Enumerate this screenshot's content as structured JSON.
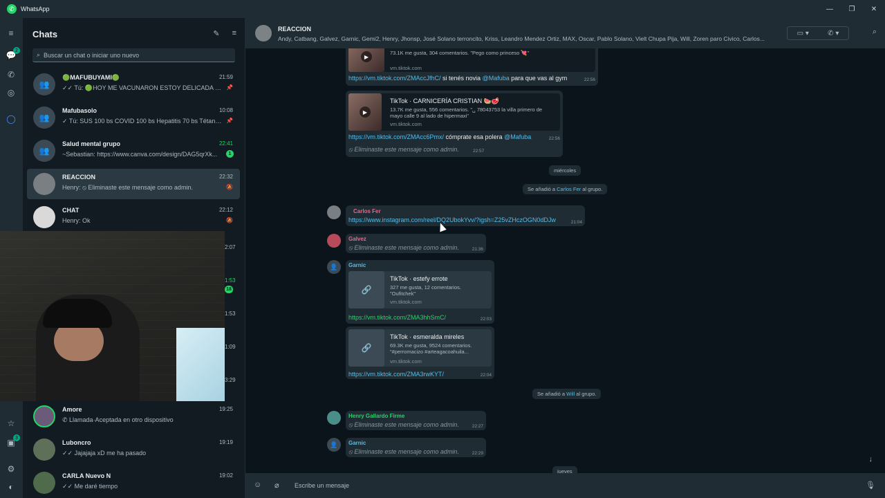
{
  "window": {
    "title": "WhatsApp"
  },
  "rail": {
    "chats_badge": "2",
    "updates_badge": "3"
  },
  "sidebar": {
    "title": "Chats",
    "search_placeholder": "Buscar un chat o iniciar uno nuevo",
    "chats": [
      {
        "name": "🟢MAFUBUYAMI🟢",
        "time": "21:59",
        "preview": "✓✓ Tú: 🟢HOY ME VACUNARON ESTOY DELICADA TRA..."
      },
      {
        "name": "Mafubasolo",
        "time": "10:08",
        "preview": "✓ Tú: SUS 100 bs COVID 100 bs Hepatitis 70 bs Tétano..."
      },
      {
        "name": "Salud mental grupo",
        "time": "22:41",
        "preview": "~Sebastian: https://www.canva.com/design/DAG5qrXk...",
        "unread": "1"
      },
      {
        "name": "REACCION",
        "time": "22:32",
        "preview": "Henry: ⦸ Eliminaste este mensaje como admin."
      },
      {
        "name": "CHAT",
        "time": "22:12",
        "preview": "Henry: Ok"
      },
      {
        "name": "Amore",
        "time": "19:25",
        "preview": "✆ Llamada·Aceptada en otro dispositivo"
      },
      {
        "name": "Luboncro",
        "time": "19:19",
        "preview": "✓✓ Jajajaja xD me ha pasado"
      },
      {
        "name": "CARLA Nuevo N",
        "time": "19:02",
        "preview": "✓✓ Me daré tiempo"
      }
    ],
    "hidden_times": [
      "2:07",
      "1:53",
      "1:53",
      "1:09",
      "3:29"
    ],
    "hidden_unread": "18"
  },
  "header": {
    "group_name": "REACCION",
    "members": "Andy, Catbang, Galvez, Garnic, Gemi2, Henry, Jhonsp, José Solano terroncito, Kriss, Leandro Mendez Ortiz, MAX, Oscar, Pablo Solano, Vielt Chupa Pija, Will, Zoren paro Civico,   Carlos..."
  },
  "messages": {
    "card1": {
      "desc": "73.1K me gusta, 304 comentarios. \"Pego como princeso 💘\"",
      "domain": "vm.tiktok.com"
    },
    "msg1": {
      "link": "https://vm.tiktok.com/ZMAccJfhC/",
      "text": " si tenés novia ",
      "mention": "@Mafuba",
      "text2": "  para que vas al gym",
      "time": "22:56"
    },
    "card2": {
      "title": "TikTok · CARNICERÍA CRISTIAN 🍉🥩",
      "desc": "13.7K me gusta, 556 comentarios. \"␣ 78043753 la villa primero de mayo calle 9 al lado de hipermaxi\"",
      "domain": "vm.tiktok.com"
    },
    "msg2": {
      "link": "https://vm.tiktok.com/ZMAcc6Pmx/",
      "text": " cómprate esa polera ",
      "mention": "@Mafuba",
      "time": "22:56"
    },
    "del1": {
      "text": "Eliminaste este mensaje como admin.",
      "time": "22:57"
    },
    "day1": "miércoles",
    "sys1": {
      "pre": "Se añadió a ",
      "name": "Carlos Fer",
      "post": " al grupo."
    },
    "carlos": {
      "sender": "Carlos Fer",
      "link": "https://www.instagram.com/reel/DQ2UbokYvv/?igsh=Z25vZHczOGN0dDJw",
      "time": "21:04"
    },
    "galvez": {
      "sender": "Galvez",
      "text": "Eliminaste este mensaje como admin.",
      "time": "21:36"
    },
    "garnic1": {
      "sender": "Garnic",
      "title": "TikTok · estefy errote",
      "desc": "327 me gusta, 12 comentarios. \"Oufitchek\"",
      "domain": "vm.tiktok.com",
      "link": "https://vm.tiktok.com/ZMA3hhSmC/",
      "time": "22:03"
    },
    "garnic2": {
      "title": "TikTok · esmeralda mireles",
      "desc": "69.3K me gusta, 9524 comentarios. \"#perromacizo #arteagacoahuila...",
      "domain": "vm.tiktok.com",
      "link": "https://vm.tiktok.com/ZMA3rwKYT/",
      "time": "22:04"
    },
    "sys2": {
      "pre": "Se añadió a ",
      "name": "Will",
      "post": " al grupo."
    },
    "henry": {
      "sender": "Henry Gallardo Firme",
      "text": "Eliminaste este mensaje como admin.",
      "time": "22:27"
    },
    "garnic3": {
      "sender": "Garnic",
      "text": "Eliminaste este mensaje como admin.",
      "time": "22:29"
    },
    "day2": "jueves"
  },
  "composer": {
    "placeholder": "Escribe un mensaje"
  },
  "colors": {
    "accent": "#00a884",
    "link": "#53bdeb",
    "bubble": "#202c33",
    "background": "#0b141a"
  }
}
